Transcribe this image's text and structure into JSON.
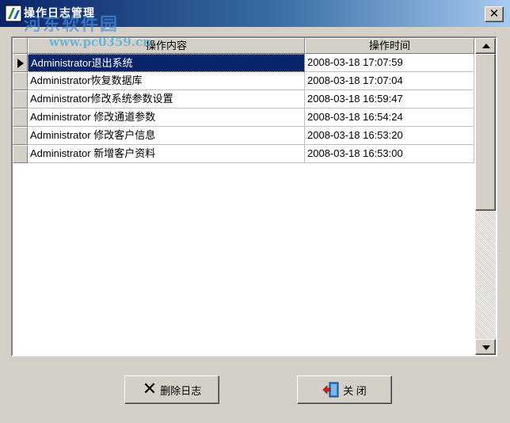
{
  "window": {
    "title": "操作日志管理",
    "close_glyph": "✕",
    "icon": "app-icon"
  },
  "watermark": {
    "site": "河东软件园",
    "url": "www.pc0359.cn"
  },
  "grid": {
    "columns": [
      "操作内容",
      "操作时间"
    ],
    "selected_row": 0,
    "rows": [
      {
        "content": "Administrator退出系统",
        "time": "2008-03-18 17:07:59"
      },
      {
        "content": "Administrator恢复数据库",
        "time": "2008-03-18 17:07:04"
      },
      {
        "content": "Administrator修改系统参数设置",
        "time": "2008-03-18 16:59:47"
      },
      {
        "content": "Administrator 修改通道参数",
        "time": "2008-03-18 16:54:24"
      },
      {
        "content": "Administrator 修改客户信息",
        "time": "2008-03-18 16:53:20"
      },
      {
        "content": "Administrator 新增客户资料",
        "time": "2008-03-18 16:53:00"
      }
    ]
  },
  "buttons": {
    "delete_label": "删除日志",
    "delete_icon": "x-icon",
    "close_label": "关 闭",
    "close_icon": "exit-door-icon"
  },
  "colors": {
    "selection": "#0a246a",
    "title_start": "#0a246a",
    "title_end": "#a6caf0",
    "face": "#d4d0c8"
  }
}
